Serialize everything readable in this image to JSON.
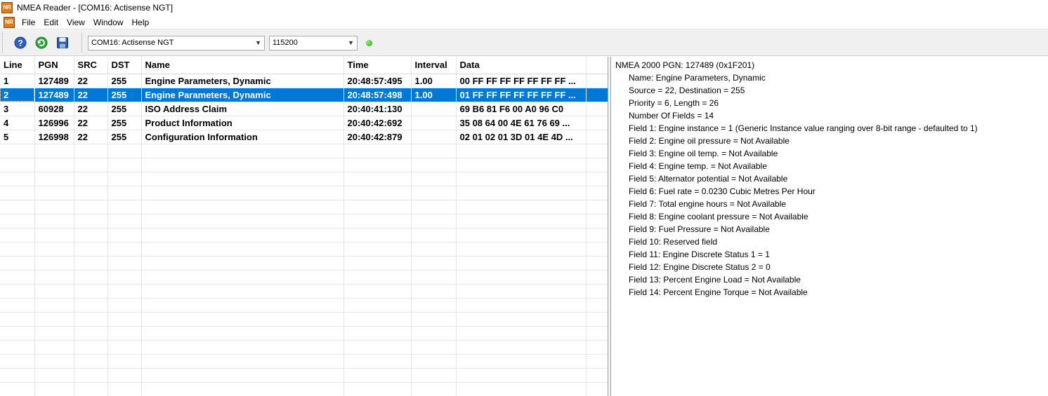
{
  "window": {
    "title": "NMEA Reader - [COM16: Actisense NGT]",
    "icon_text": "NR"
  },
  "menu": {
    "icon_text": "NR",
    "items": [
      "File",
      "Edit",
      "View",
      "Window",
      "Help"
    ]
  },
  "toolbar": {
    "port_select": "COM16: Actisense NGT",
    "baud_select": "115200",
    "buttons": [
      "help-icon",
      "refresh-icon",
      "save-icon"
    ],
    "led_color": "#22b422"
  },
  "table": {
    "columns": [
      "Line",
      "PGN",
      "SRC",
      "DST",
      "Name",
      "Time",
      "Interval",
      "Data"
    ],
    "selected_row": 1,
    "rows": [
      [
        "1",
        "127489",
        "22",
        "255",
        "Engine Parameters, Dynamic",
        "20:48:57:495",
        "1.00",
        "00 FF FF FF FF FF FF FF ..."
      ],
      [
        "2",
        "127489",
        "22",
        "255",
        "Engine Parameters, Dynamic",
        "20:48:57:498",
        "1.00",
        "01 FF FF FF FF FF FF FF ..."
      ],
      [
        "3",
        "60928",
        "22",
        "255",
        "ISO Address Claim",
        "20:40:41:130",
        "",
        "69 B6 81 F6 00 A0 96 C0"
      ],
      [
        "4",
        "126996",
        "22",
        "255",
        "Product Information",
        "20:40:42:692",
        "",
        "35 08 64 00 4E 61 76 69 ..."
      ],
      [
        "5",
        "126998",
        "22",
        "255",
        "Configuration Information",
        "20:40:42:879",
        "",
        "02 01 02 01 3D 01 4E 4D ..."
      ]
    ]
  },
  "details": {
    "header": "NMEA 2000 PGN: 127489 (0x1F201)",
    "lines": [
      "Name: Engine Parameters, Dynamic",
      "Source = 22, Destination = 255",
      "Priority = 6, Length = 26",
      "Number Of Fields = 14",
      "Field 1: Engine instance = 1 (Generic Instance value ranging over 8-bit range - defaulted to 1)",
      "Field 2: Engine oil pressure = Not Available",
      "Field 3: Engine oil temp. = Not Available",
      "Field 4: Engine temp. = Not Available",
      "Field 5: Alternator potential = Not Available",
      "Field 6: Fuel rate = 0.0230 Cubic Metres Per Hour",
      "Field 7: Total engine hours = Not Available",
      "Field 8: Engine coolant pressure = Not Available",
      "Field 9: Fuel Pressure = Not Available",
      "Field 10: Reserved field",
      "Field 11: Engine Discrete Status 1 = 1",
      "Field 12: Engine Discrete Status 2 = 0",
      "Field 13: Percent Engine Load = Not Available",
      "Field 14: Percent Engine Torque = Not Available"
    ]
  }
}
